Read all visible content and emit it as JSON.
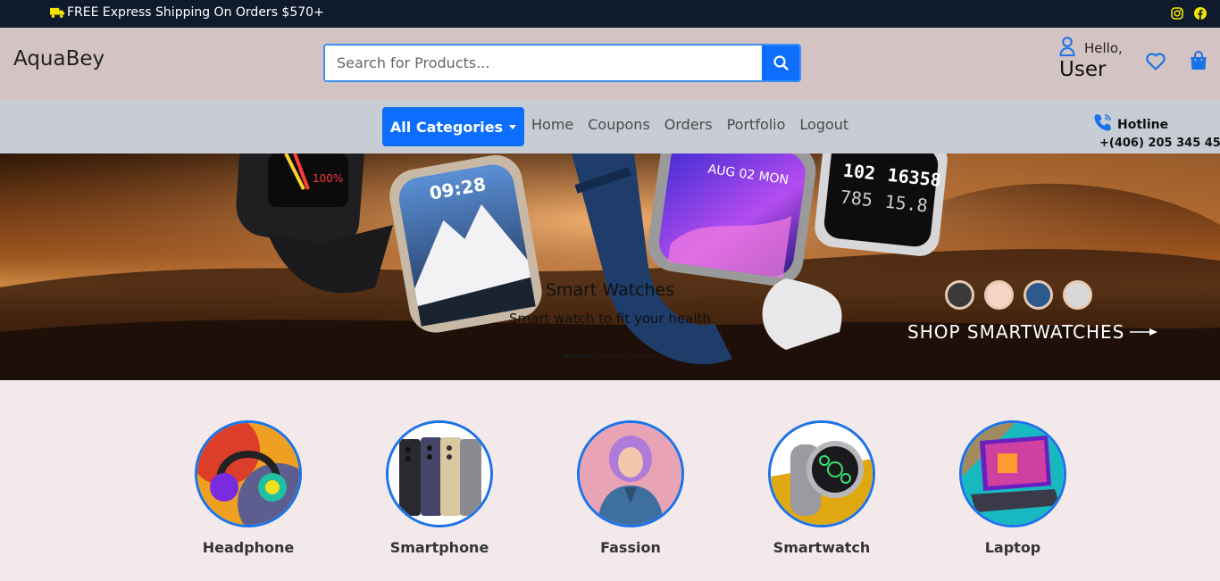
{
  "topbar": {
    "shipping_text": "FREE Express Shipping On Orders $570+",
    "icons": [
      "truck-icon",
      "instagram-icon",
      "facebook-icon"
    ]
  },
  "header": {
    "logo": "AquaBey",
    "search_placeholder": "Search for Products...",
    "greeting": "Hello,",
    "username": "User"
  },
  "nav": {
    "categories_label": "All Categories",
    "links": [
      "Home",
      "Coupons",
      "Orders",
      "Portfolio",
      "Logout"
    ],
    "hotline_label": "Hotline",
    "hotline_number": "+(406) 205 345 45"
  },
  "hero": {
    "title": "Smart Watches",
    "subtitle": "Smart watch to fit your health",
    "cta": "SHOP SMARTWATCHES",
    "slides": 3,
    "active_slide": 1,
    "swatch_colors": [
      "#3a3a3a",
      "#f6d5c8",
      "#2d5a8c",
      "#d8d8d8"
    ]
  },
  "categories": [
    {
      "label": "Headphone"
    },
    {
      "label": "Smartphone"
    },
    {
      "label": "Fassion"
    },
    {
      "label": "Smartwatch"
    },
    {
      "label": "Laptop"
    }
  ],
  "colors": {
    "primary": "#0d6efd",
    "topbar_bg": "#0f1b2d",
    "header_bg": "#d3c4c3",
    "nav_bg": "#c8ccd5",
    "accent_yellow": "#f5e400"
  }
}
